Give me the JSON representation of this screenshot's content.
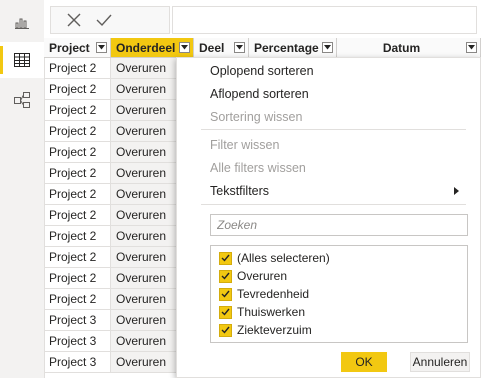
{
  "toolbar": {
    "cancel_icon": "close-icon",
    "confirm_icon": "check-icon",
    "formula_value": ""
  },
  "sidebar": {
    "items": [
      {
        "icon": "report-view-icon",
        "active": false
      },
      {
        "icon": "data-view-icon",
        "active": true
      },
      {
        "icon": "model-view-icon",
        "active": false
      }
    ]
  },
  "columns": [
    {
      "label": "Project",
      "selected": false
    },
    {
      "label": "Onderdeel",
      "selected": true
    },
    {
      "label": "Deel",
      "selected": false
    },
    {
      "label": "Percentage",
      "selected": false
    },
    {
      "label": "Datum",
      "selected": false
    }
  ],
  "rows": [
    {
      "project": "Project 2",
      "onderdeel": "Overuren"
    },
    {
      "project": "Project 2",
      "onderdeel": "Overuren"
    },
    {
      "project": "Project 2",
      "onderdeel": "Overuren"
    },
    {
      "project": "Project 2",
      "onderdeel": "Overuren"
    },
    {
      "project": "Project 2",
      "onderdeel": "Overuren"
    },
    {
      "project": "Project 2",
      "onderdeel": "Overuren"
    },
    {
      "project": "Project 2",
      "onderdeel": "Overuren"
    },
    {
      "project": "Project 2",
      "onderdeel": "Overuren"
    },
    {
      "project": "Project 2",
      "onderdeel": "Overuren"
    },
    {
      "project": "Project 2",
      "onderdeel": "Overuren"
    },
    {
      "project": "Project 2",
      "onderdeel": "Overuren"
    },
    {
      "project": "Project 2",
      "onderdeel": "Overuren"
    },
    {
      "project": "Project 3",
      "onderdeel": "Overuren"
    },
    {
      "project": "Project 3",
      "onderdeel": "Overuren"
    },
    {
      "project": "Project 3",
      "onderdeel": "Overuren"
    }
  ],
  "menu": {
    "sort_asc": "Oplopend sorteren",
    "sort_desc": "Aflopend sorteren",
    "clear_sort": "Sortering wissen",
    "clear_filter": "Filter wissen",
    "clear_all_filters": "Alle filters wissen",
    "text_filters": "Tekstfilters",
    "search_placeholder": "Zoeken",
    "options": [
      {
        "label": "(Alles selecteren)",
        "checked": true
      },
      {
        "label": "Overuren",
        "checked": true
      },
      {
        "label": "Tevredenheid",
        "checked": true
      },
      {
        "label": "Thuiswerken",
        "checked": true
      },
      {
        "label": "Ziekteverzuim",
        "checked": true
      }
    ],
    "ok_label": "OK",
    "cancel_label": "Annuleren"
  },
  "colors": {
    "accent": "#f2c811",
    "disabled_text": "#a19f9d"
  }
}
